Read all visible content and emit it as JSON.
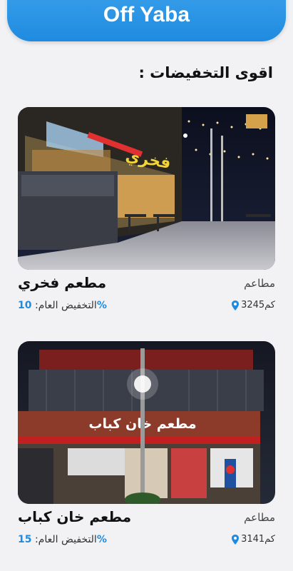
{
  "header": {
    "title": "Off Yaba"
  },
  "section": {
    "title": "اقوى التخفيضات :"
  },
  "cards": [
    {
      "name": "مطعم فخري",
      "category": "مطاعم",
      "distance": "3245كم",
      "discount_label": "التخفيض العام:",
      "discount_value": "10",
      "percent_symbol": "%",
      "sign_text": "فخري"
    },
    {
      "name": "مطعم خان كباب",
      "category": "مطاعم",
      "distance": "3141كم",
      "discount_label": "التخفيض العام:",
      "discount_value": "15",
      "percent_symbol": "%",
      "sign_text": "مطعم خان كباب"
    }
  ],
  "colors": {
    "accent": "#1f8be0",
    "header": "#3aa0ea"
  },
  "icons": {
    "location": "location-pin-icon"
  }
}
